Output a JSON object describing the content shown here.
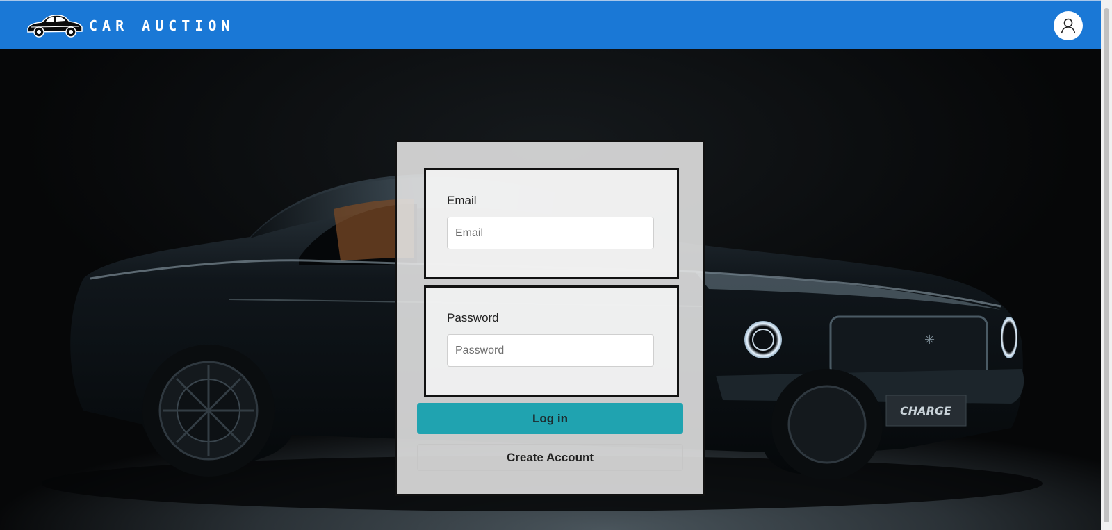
{
  "navbar": {
    "title": "CAR AUCTION",
    "logo_icon": "car-icon",
    "account_icon": "user-icon",
    "bg_color": "#1a78d6"
  },
  "hero": {
    "image": "dark muscle car",
    "plate_text": "CHARGE"
  },
  "login": {
    "email_label": "Email",
    "email_placeholder": "Email",
    "email_value": "",
    "password_label": "Password",
    "password_placeholder": "Password",
    "password_value": "",
    "login_label": "Log in",
    "login_color": "#20a3b0",
    "create_label": "Create Account"
  }
}
